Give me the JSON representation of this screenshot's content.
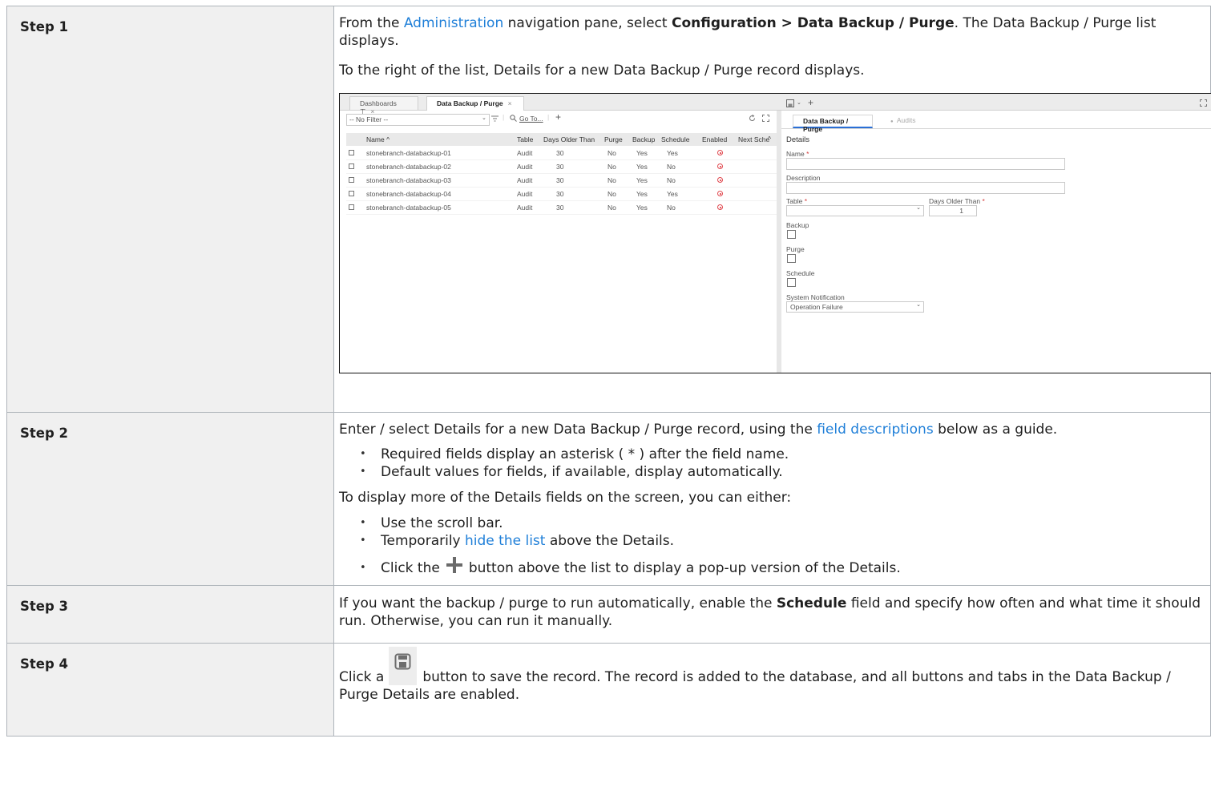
{
  "steps": [
    {
      "label": "Step 1"
    },
    {
      "label": "Step 2"
    },
    {
      "label": "Step 3"
    },
    {
      "label": "Step 4"
    }
  ],
  "step1": {
    "line1_before": "From the ",
    "line1_link": "Administration",
    "line1_middle": " navigation pane, select ",
    "line1_bold": "Configuration > Data Backup / Purge",
    "line1_after": ". The Data Backup / Purge list displays.",
    "line2": "To the right of the list, Details for a new Data Backup / Purge record displays."
  },
  "screenshot": {
    "tabs": [
      {
        "label": "Dashboards",
        "pin": "⊤",
        "close": "×"
      },
      {
        "label": "Data Backup / Purge",
        "close": "×"
      }
    ],
    "filter_value": "-- No Filter --",
    "goto_label": "Go To...",
    "plus": "+",
    "columns": [
      "Name",
      "Table",
      "Days Older Than",
      "Purge",
      "Backup",
      "Schedule",
      "Enabled",
      "Next Sche"
    ],
    "sort_caret": "^",
    "rows": [
      {
        "name": "stonebranch-databackup-01",
        "table": "Audit",
        "days": "30",
        "purge": "No",
        "backup": "Yes",
        "schedule": "Yes"
      },
      {
        "name": "stonebranch-databackup-02",
        "table": "Audit",
        "days": "30",
        "purge": "No",
        "backup": "Yes",
        "schedule": "No"
      },
      {
        "name": "stonebranch-databackup-03",
        "table": "Audit",
        "days": "30",
        "purge": "No",
        "backup": "Yes",
        "schedule": "No"
      },
      {
        "name": "stonebranch-databackup-04",
        "table": "Audit",
        "days": "30",
        "purge": "No",
        "backup": "Yes",
        "schedule": "Yes"
      },
      {
        "name": "stonebranch-databackup-05",
        "table": "Audit",
        "days": "30",
        "purge": "No",
        "backup": "Yes",
        "schedule": "No"
      }
    ],
    "detail_tabs": [
      "Data Backup / Purge",
      "Audits"
    ],
    "details_title": "Details",
    "fields": {
      "name": "Name",
      "description": "Description",
      "table": "Table",
      "days": "Days Older Than",
      "days_value": "1",
      "backup": "Backup",
      "purge": "Purge",
      "schedule": "Schedule",
      "notification": "System Notification",
      "notification_value": "Operation Failure"
    },
    "asterisk": "*",
    "colors": {
      "enabled": "#e0464d",
      "accent": "#2a6fd6"
    }
  },
  "step2": {
    "intro_before": "Enter / select Details for a new Data Backup / Purge record, using the ",
    "intro_link": "field descriptions",
    "intro_after": " below as a guide.",
    "bullets1": [
      "Required fields display an asterisk ( * ) after the field name.",
      "Default values for fields, if available, display automatically."
    ],
    "more": "To display more of the Details fields on the screen, you can either:",
    "b_scroll": "Use the scroll bar.",
    "b_hide_before": "Temporarily ",
    "b_hide_link": "hide the list",
    "b_hide_after": " above the Details.",
    "b_click_before": "Click the",
    "b_click_after": "button above the list to display a pop-up version of the Details."
  },
  "step3": {
    "before": "If you want the backup / purge to run automatically, enable the ",
    "bold": "Schedule",
    "after": " field and specify how often and what time it should run. Otherwise, you can run it manually."
  },
  "step4": {
    "before": "Click a",
    "after": "button to save the record. The record is added to the database, and all buttons and tabs in the Data Backup / Purge Details are enabled."
  }
}
